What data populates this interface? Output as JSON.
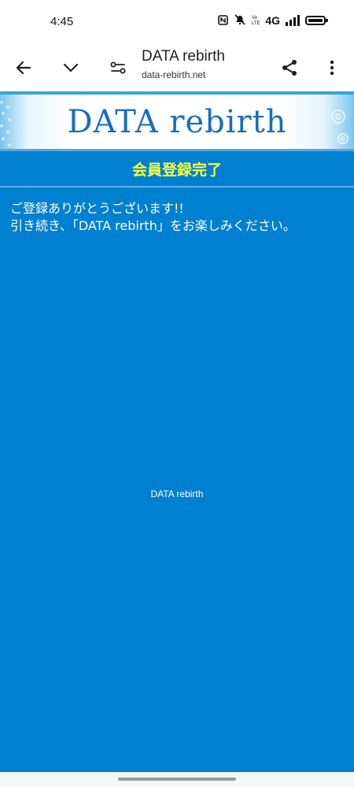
{
  "status_bar": {
    "time": "4:45",
    "network_label": "4G"
  },
  "browser": {
    "title": "DATA rebirth",
    "url": "data-rebirth.net",
    "icons": [
      "arrow-back-icon",
      "chevron-down-icon",
      "page-settings-icon",
      "share-icon",
      "more-vert-icon"
    ]
  },
  "banner": {
    "logo_text": "DATA rebirth"
  },
  "page": {
    "heading": "会員登録完了",
    "message_lines": [
      "ご登録ありがとうございます!!",
      "引き続き、「DATA rebirth」をお楽しみください。"
    ],
    "footer_text": "DATA rebirth"
  },
  "colors": {
    "page_background": "#0080d0",
    "heading_text": "#ffff33",
    "logo_text": "#1a6cc0"
  }
}
